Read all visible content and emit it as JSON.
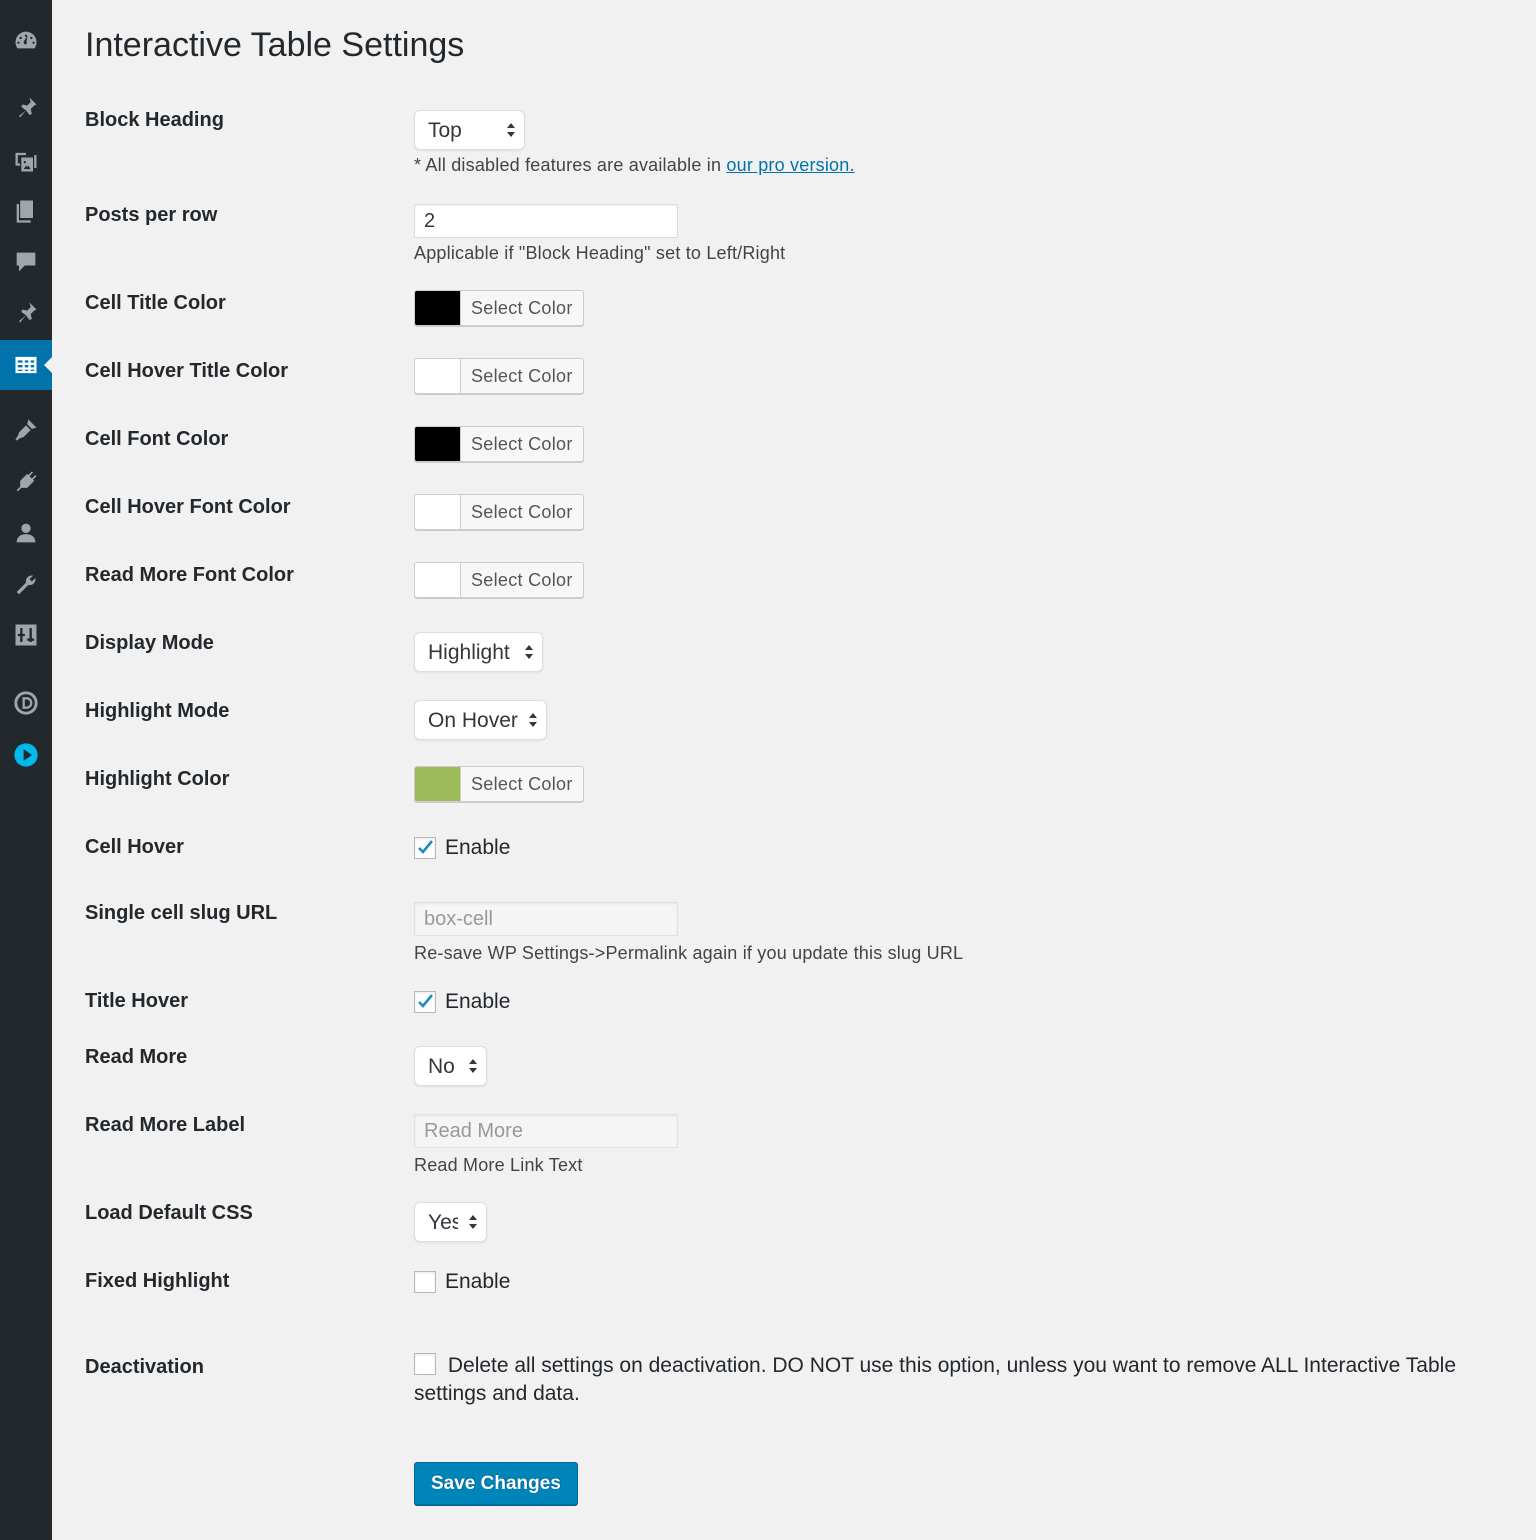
{
  "page": {
    "title": "Interactive Table Settings"
  },
  "sidebar": {
    "icons": [
      "dashboard-icon",
      "pin-icon",
      "media-icon",
      "pages-icon",
      "comments-icon",
      "pin-icon",
      "table-icon",
      "appearance-icon",
      "plugins-icon",
      "users-icon",
      "tools-icon",
      "settings-icon",
      "divi-icon",
      "play-icon"
    ],
    "active": "table-icon",
    "accent": "#0073aa"
  },
  "settings": {
    "block_heading": {
      "label": "Block Heading",
      "value": "Top",
      "note_prefix": "* All disabled features are available in",
      "note_link": "our pro version."
    },
    "posts_per_row": {
      "label": "Posts per row",
      "value": "2",
      "desc": "Applicable if \"Block Heading\" set to Left/Right"
    },
    "cell_title_color": {
      "label": "Cell Title Color",
      "button": "Select Color",
      "color": "#000000"
    },
    "cell_hover_title_color": {
      "label": "Cell Hover Title Color",
      "button": "Select Color",
      "color": "#ffffff"
    },
    "cell_font_color": {
      "label": "Cell Font Color",
      "button": "Select Color",
      "color": "#000000"
    },
    "cell_hover_font_color": {
      "label": "Cell Hover Font Color",
      "button": "Select Color",
      "color": "#ffffff"
    },
    "read_more_font_color": {
      "label": "Read More Font Color",
      "button": "Select Color",
      "color": "#ffffff"
    },
    "display_mode": {
      "label": "Display Mode",
      "value": "Highlight"
    },
    "highlight_mode": {
      "label": "Highlight Mode",
      "value": "On Hover"
    },
    "highlight_color": {
      "label": "Highlight Color",
      "button": "Select Color",
      "color": "#9bbb59"
    },
    "cell_hover": {
      "label": "Cell Hover",
      "option": "Enable",
      "checked": true
    },
    "single_cell_slug": {
      "label": "Single cell slug URL",
      "value": "box-cell",
      "desc": "Re-save WP Settings->Permalink again if you update this slug URL"
    },
    "title_hover": {
      "label": "Title Hover",
      "option": "Enable",
      "checked": true
    },
    "read_more": {
      "label": "Read More",
      "value": "No"
    },
    "read_more_label": {
      "label": "Read More Label",
      "value": "Read More",
      "desc": "Read More Link Text"
    },
    "load_default_css": {
      "label": "Load Default CSS",
      "value": "Yes"
    },
    "fixed_highlight": {
      "label": "Fixed Highlight",
      "option": "Enable",
      "checked": false
    },
    "deactivation": {
      "label": "Deactivation",
      "option": "Delete all settings on deactivation. DO NOT use this option, unless you want to remove ALL Interactive Table settings and data.",
      "checked": false
    }
  },
  "actions": {
    "save": "Save Changes"
  }
}
